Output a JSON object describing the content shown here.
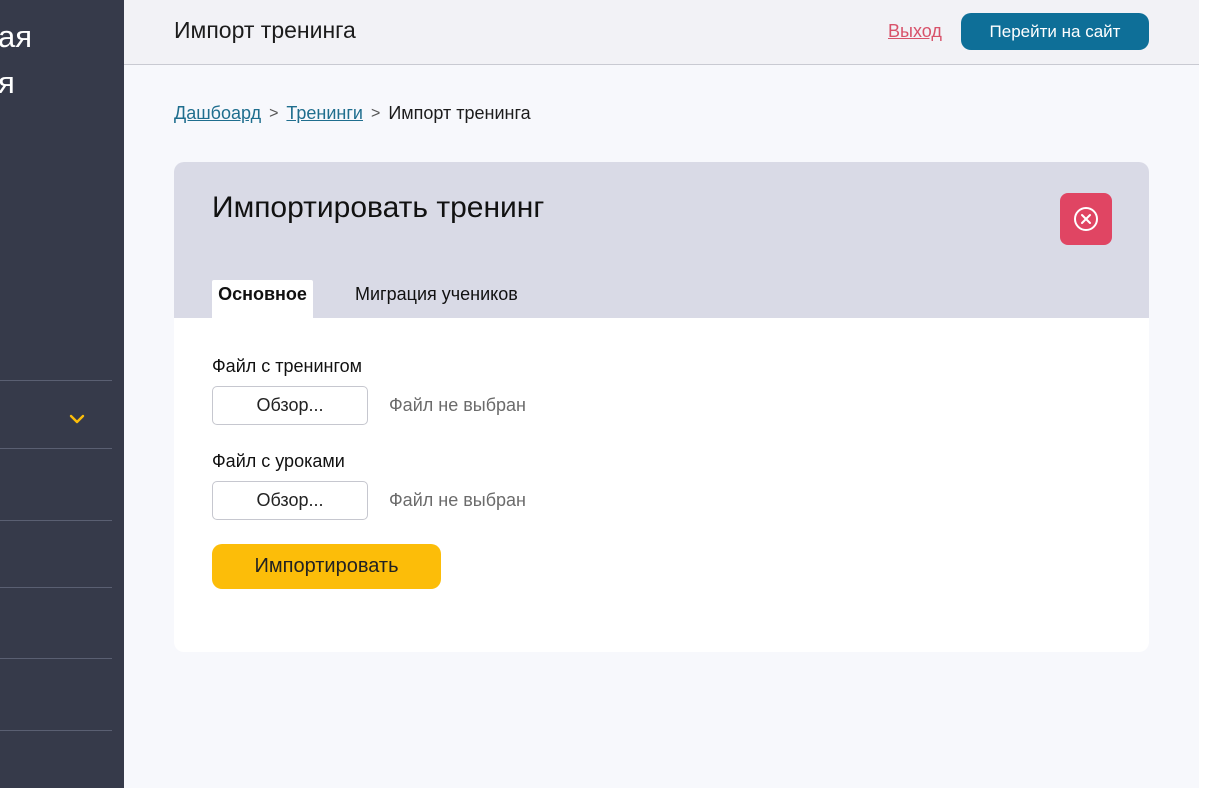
{
  "sidebar": {
    "brand_lines": [
      "ая",
      "я"
    ],
    "expand_icon": "chevron-down-icon",
    "accent_color": "#fcbd09"
  },
  "header": {
    "title": "Импорт тренинга",
    "logout_label": "Выход",
    "site_button_label": "Перейти на сайт"
  },
  "breadcrumb": {
    "items": [
      "Дашбоард",
      "Тренинги",
      "Импорт тренинга"
    ]
  },
  "card": {
    "title": "Импортировать тренинг",
    "close_icon": "close-circle-icon",
    "tabs": [
      {
        "label": "Основное",
        "active": true
      },
      {
        "label": "Миграция учеников",
        "active": false
      }
    ],
    "fields": [
      {
        "label": "Файл с тренингом",
        "button_label": "Обзор...",
        "status": "Файл не выбран"
      },
      {
        "label": "Файл с уроками",
        "button_label": "Обзор...",
        "status": "Файл не выбран"
      }
    ],
    "submit_label": "Импортировать"
  },
  "colors": {
    "sidebar_bg": "#363a4a",
    "primary": "#0e6f98",
    "danger": "#e04563",
    "accent": "#fcbd09",
    "card_header_bg": "#d9dae6"
  }
}
